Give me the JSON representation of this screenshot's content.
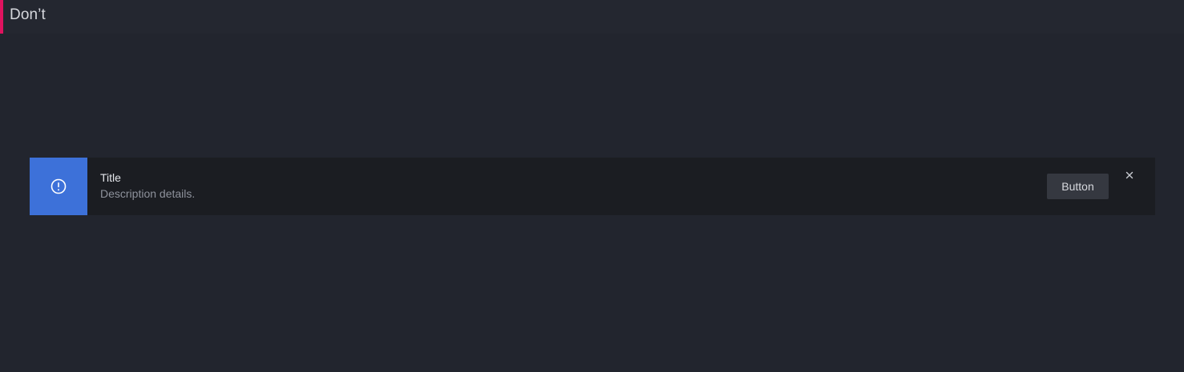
{
  "section": {
    "title": "Don’t",
    "accent_color": "#e0135f"
  },
  "alert": {
    "icon": "info-circle-icon",
    "icon_bg_color": "#3d71d9",
    "title": "Title",
    "description": "Description details.",
    "button_label": "Button",
    "close_icon": "close-icon"
  }
}
